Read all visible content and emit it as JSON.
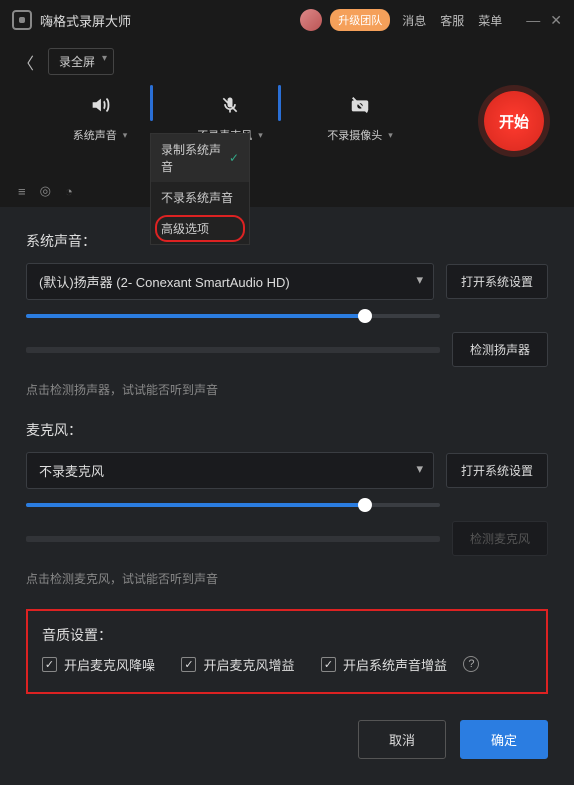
{
  "titlebar": {
    "app_name": "嗨格式录屏大师",
    "upgrade": "升级团队",
    "links": [
      "消息",
      "客服",
      "菜单"
    ]
  },
  "mode": {
    "selected": "录全屏"
  },
  "controls": {
    "system_sound": "系统声音",
    "microphone": "不录麦克风",
    "camera": "不录摄像头",
    "start": "开始"
  },
  "dropdown": {
    "item1": "录制系统声音",
    "item2": "不录系统声音",
    "item3": "高级选项"
  },
  "settings": {
    "system_sound_label": "系统声音：",
    "system_device": "(默认)扬声器 (2- Conexant SmartAudio HD)",
    "open_system": "打开系统设置",
    "detect_speaker": "检测扬声器",
    "speaker_hint": "点击检测扬声器，试试能否听到声音",
    "mic_label": "麦克风：",
    "mic_device": "不录麦克风",
    "open_system2": "打开系统设置",
    "detect_mic": "检测麦克风",
    "mic_hint": "点击检测麦克风，试试能否听到声音",
    "quality_label": "音质设置：",
    "cb1": "开启麦克风降噪",
    "cb2": "开启麦克风增益",
    "cb3": "开启系统声音增益",
    "cancel": "取消",
    "ok": "确定"
  },
  "slider": {
    "sys_pct": 82,
    "mic_pct": 82
  }
}
